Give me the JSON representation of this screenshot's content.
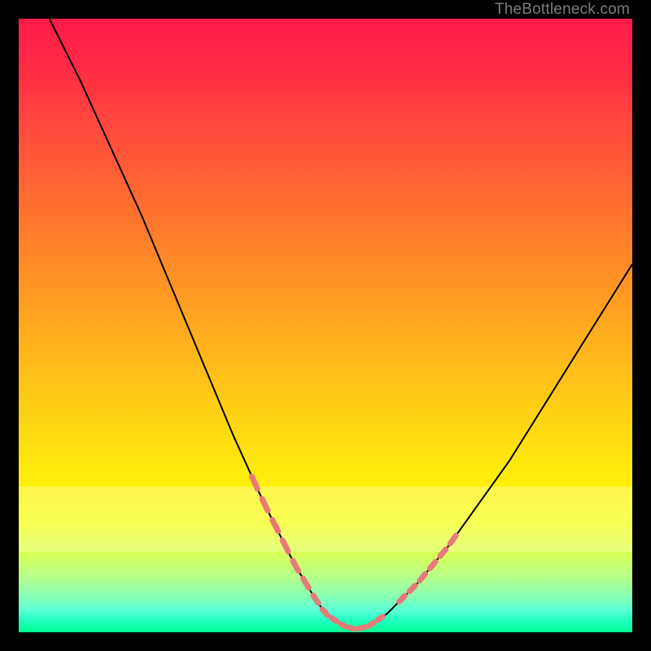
{
  "watermark": "TheBottleneck.com",
  "chart_data": {
    "type": "line",
    "title": "",
    "xlabel": "",
    "ylabel": "",
    "xlim": [
      0,
      100
    ],
    "ylim": [
      0,
      100
    ],
    "grid": false,
    "series": [
      {
        "name": "curve",
        "x": [
          5,
          10,
          15,
          20,
          25,
          30,
          35,
          40,
          45,
          48,
          50,
          53,
          55,
          57,
          60,
          65,
          70,
          75,
          80,
          85,
          90,
          95,
          100
        ],
        "y": [
          100,
          90,
          79,
          68,
          56,
          44,
          32,
          21,
          11,
          6,
          3,
          1,
          0.5,
          1,
          3,
          8,
          14,
          21,
          28,
          36,
          44,
          52,
          60
        ]
      }
    ],
    "highlight_segments": [
      {
        "name": "left-dashes",
        "x_range": [
          38,
          48
        ]
      },
      {
        "name": "valley-dashes",
        "x_range": [
          48,
          60
        ]
      },
      {
        "name": "right-dashes",
        "x_range": [
          62,
          72
        ]
      }
    ],
    "colors": {
      "curve": "#000000",
      "highlight": "#e77a79",
      "background_top": "#ff1b4a",
      "background_bottom": "#00ff8f"
    }
  }
}
